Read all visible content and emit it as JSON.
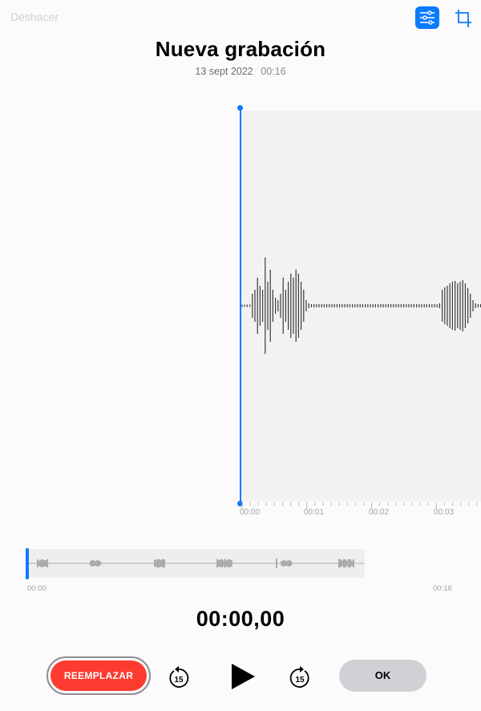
{
  "toolbar": {
    "undo_label": "Deshacer",
    "filter_icon": "sliders-icon",
    "crop_icon": "crop-icon",
    "accent_color": "#0a7aff"
  },
  "recording": {
    "title": "Nueva grabación",
    "date": "13 sept 2022",
    "duration": "00:16"
  },
  "waveform": {
    "time_labels": [
      "00:00",
      "00:01",
      "00:02",
      "00:03"
    ]
  },
  "overview": {
    "start_label": "00:00",
    "end_label": "00:16"
  },
  "playback": {
    "current_time": "00:00,00",
    "skip_seconds": "15"
  },
  "controls": {
    "replace_label": "REEMPLAZAR",
    "ok_label": "OK",
    "replace_color": "#fe3b30"
  }
}
